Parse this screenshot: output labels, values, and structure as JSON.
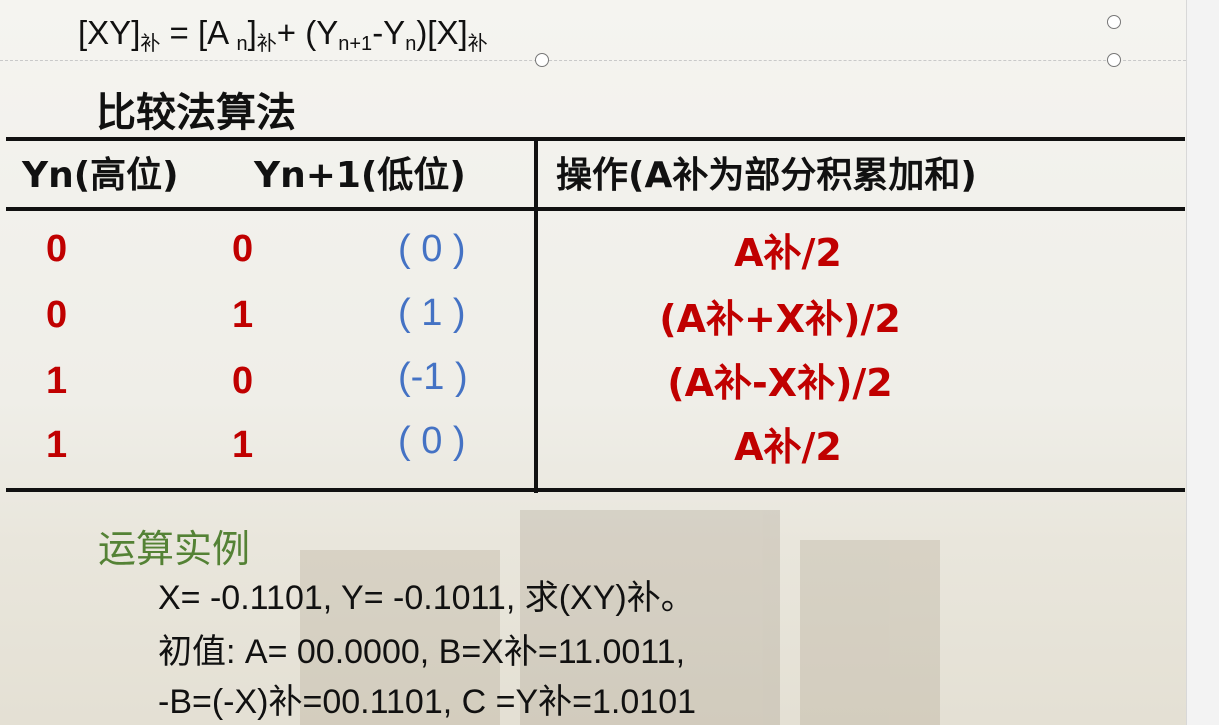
{
  "formula": {
    "lhs": "[XY]",
    "lhs_sub": "补",
    "eq": " = [A ",
    "an_sub": "n",
    "close1": "]",
    "an_sub2": "补",
    "plus": "+ (Y",
    "yn1_sub": "n+1",
    "minus": "-Y",
    "yn_sub": "n",
    "close2": ")[X]",
    "x_sub": "补"
  },
  "heading": "比较法算法",
  "table": {
    "headers": [
      "Yn(高位)",
      "Yn+1(低位)",
      "操作(A补为部分积累加和)"
    ],
    "rows": [
      {
        "yn": "0",
        "yn1": "0",
        "val": "( 0 )",
        "op": "A补/2"
      },
      {
        "yn": "0",
        "yn1": "1",
        "val": "( 1 )",
        "op": "(A补+X补)/2"
      },
      {
        "yn": "1",
        "yn1": "0",
        "val": "(-1 )",
        "op": "(A补-X补)/2"
      },
      {
        "yn": "1",
        "yn1": "1",
        "val": "( 0 )",
        "op": "A补/2"
      }
    ]
  },
  "example": {
    "title": "运算实例",
    "lines": [
      "X= -0.1101, Y= -0.1011, 求(XY)补。",
      "初值: A= 00.0000, B=X补=11.0011,",
      "-B=(-X)补=00.1101, C =Y补=1.0101"
    ]
  },
  "colors": {
    "accent_red": "#c00000",
    "value_blue": "#4472c4",
    "title_green": "#548235"
  }
}
